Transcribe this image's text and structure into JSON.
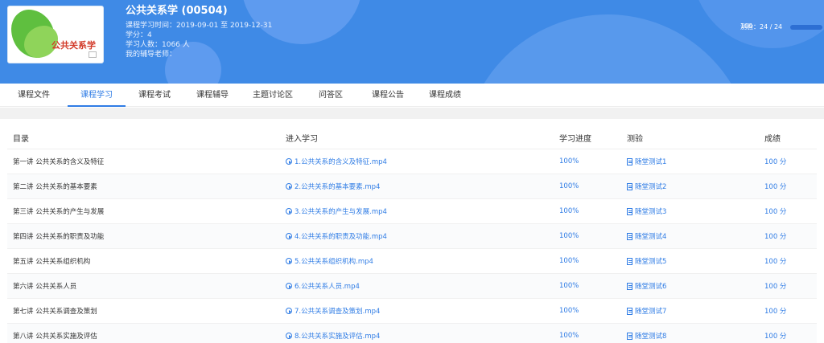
{
  "course": {
    "cover_title": "公共关系学",
    "title": "公共关系学 (00504)",
    "study_time": "课程学习时间：2019-09-01 至 2019-12-31",
    "credits": "学分：4",
    "students": "学习人数：1066 人",
    "tutor": "我的辅导老师："
  },
  "test_summary": {
    "label": "测验：",
    "value": "24 / 24",
    "progress": 1.0,
    "percent_text": "100"
  },
  "tabs": [
    {
      "label": "课程文件",
      "active": false
    },
    {
      "label": "课程学习",
      "active": true
    },
    {
      "label": "课程考试",
      "active": false
    },
    {
      "label": "课程辅导",
      "active": false
    },
    {
      "label": "主题讨论区",
      "active": false
    },
    {
      "label": "问答区",
      "active": false
    },
    {
      "label": "课程公告",
      "active": false
    },
    {
      "label": "课程成绩",
      "active": false
    }
  ],
  "table": {
    "headers": [
      "目录",
      "进入学习",
      "学习进度",
      "测验",
      "成绩"
    ],
    "rows": [
      {
        "chapter": "第一讲 公共关系的含义及特征",
        "video": "1.公共关系的含义及特征.mp4",
        "progress": "100%",
        "quiz": "随堂测试1",
        "score": "100 分"
      },
      {
        "chapter": "第二讲 公共关系的基本要素",
        "video": "2.公共关系的基本要素.mp4",
        "progress": "100%",
        "quiz": "随堂测试2",
        "score": "100 分"
      },
      {
        "chapter": "第三讲 公共关系的产生与发展",
        "video": "3.公共关系的产生与发展.mp4",
        "progress": "100%",
        "quiz": "随堂测试3",
        "score": "100 分"
      },
      {
        "chapter": "第四讲 公共关系的职责及功能",
        "video": "4.公共关系的职责及功能.mp4",
        "progress": "100%",
        "quiz": "随堂测试4",
        "score": "100 分"
      },
      {
        "chapter": "第五讲 公共关系组织机构",
        "video": "5.公共关系组织机构.mp4",
        "progress": "100%",
        "quiz": "随堂测试5",
        "score": "100 分"
      },
      {
        "chapter": "第六讲 公共关系人员",
        "video": "6.公共关系人员.mp4",
        "progress": "100%",
        "quiz": "随堂测试6",
        "score": "100 分"
      },
      {
        "chapter": "第七讲 公共关系调查及策划",
        "video": "7.公共关系调查及策划.mp4",
        "progress": "100%",
        "quiz": "随堂测试7",
        "score": "100 分"
      },
      {
        "chapter": "第八讲 公共关系实施及评估",
        "video": "8.公共关系实施及评估.mp4",
        "progress": "100%",
        "quiz": "随堂测试8",
        "score": "100 分"
      }
    ]
  },
  "colors": {
    "banner": "#3f8ae6",
    "accent": "#2f7ce5"
  }
}
